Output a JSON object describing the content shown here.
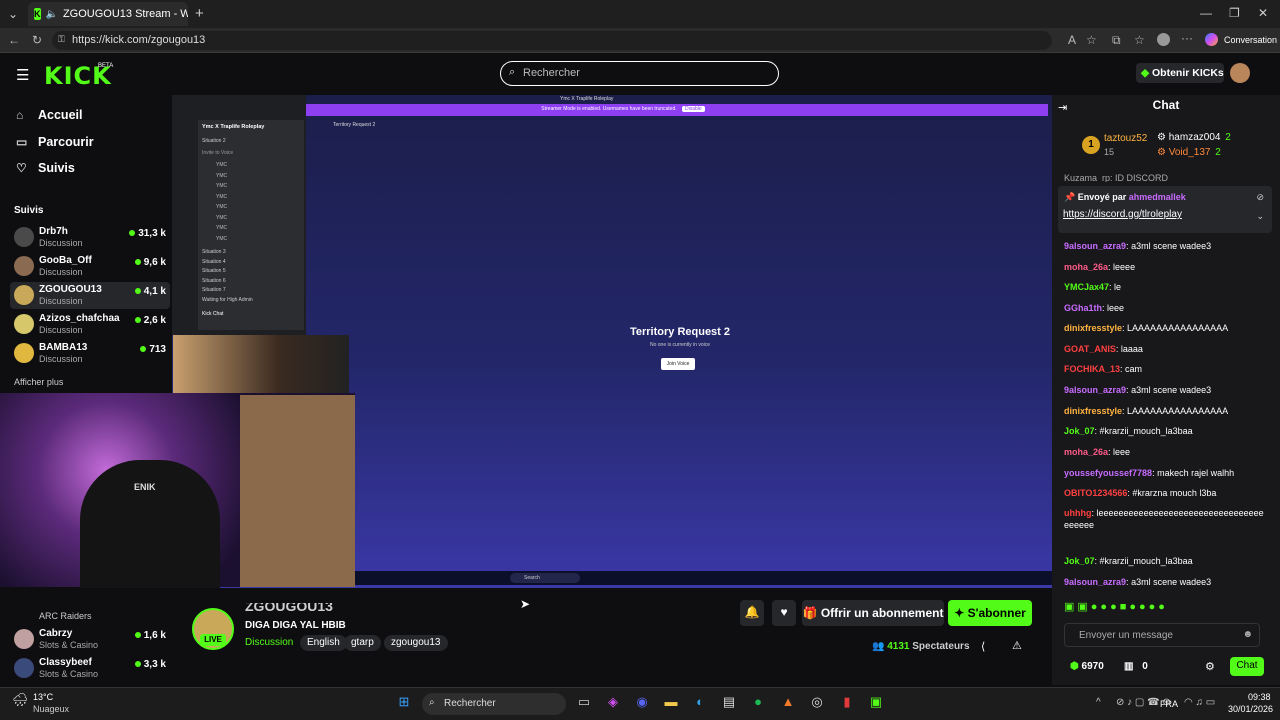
{
  "browser": {
    "tab_title": "ZGOUGOU13 Stream - Watch",
    "url": "https://kick.com/zgougou13",
    "conversation_label": "Conversation"
  },
  "header": {
    "logo": "KICK",
    "beta": "BETA",
    "search_placeholder": "Rechercher",
    "get_kicks": "Obtenir KICKs"
  },
  "sidebar": {
    "nav": [
      {
        "label": "Accueil"
      },
      {
        "label": "Parcourir"
      },
      {
        "label": "Suivis"
      }
    ],
    "section_title": "Suivis",
    "following": [
      {
        "name": "Drb7h",
        "category": "Discussion",
        "viewers": "31,3 k"
      },
      {
        "name": "GooBa_Off",
        "category": "Discussion",
        "viewers": "9,6 k"
      },
      {
        "name": "ZGOUGOU13",
        "category": "Discussion",
        "viewers": "4,1 k"
      },
      {
        "name": "Azizos_chafchaa",
        "category": "Discussion",
        "viewers": "2,6 k"
      },
      {
        "name": "BAMBA13",
        "category": "Discussion",
        "viewers": "713"
      }
    ],
    "show_more": "Afficher plus",
    "recommended_partial": "ARC Raiders",
    "recommended": [
      {
        "name": "Cabrzy",
        "category": "Slots & Casino",
        "viewers": "1,6 k"
      },
      {
        "name": "Classybeef",
        "category": "Slots & Casino",
        "viewers": "3,3 k"
      }
    ]
  },
  "player": {
    "window_title": "Ymc X Traplife Roleplay",
    "banner": "Streamer Mode is enabled. Usernames have been truncated.",
    "banner_btn": "Disable",
    "server_name": "Ymc X Traplife Roleplay",
    "channel_header": "Territory Request 2",
    "channels": [
      "Situation 2",
      "Invite to Voice",
      "Situation 3",
      "Situation 4",
      "Situation 5",
      "Situation 6",
      "Situation 7",
      "Waiting for High Admin",
      "Kick Chat"
    ],
    "voice_users": [
      "YMC",
      "YMC",
      "YMC",
      "YMC",
      "YMC",
      "YMC",
      "YMC",
      "YMC"
    ],
    "center_title": "Territory Request 2",
    "center_sub": "No one is currently in voice",
    "join_btn": "Join Voice",
    "mini_taskbar_search": "Search",
    "hoodie_text": "ENIK"
  },
  "stream": {
    "streamer_name": "ZGOUGOU13",
    "live": "LIVE",
    "title": "DIGA DIGA YAL HBIB",
    "category": "Discussion",
    "tags": [
      "English",
      "gtarp",
      "zgougou13"
    ],
    "gift_btn": "Offrir un abonnement",
    "sub_btn": "S'abonner",
    "viewers": "4131",
    "viewers_label": "Spectateurs"
  },
  "chat": {
    "title": "Chat",
    "top_gifters": [
      {
        "name": "taztouz52",
        "count": "15"
      },
      {
        "name": "hamzaz004",
        "count": "2"
      },
      {
        "name": "Void_137",
        "count": "2"
      }
    ],
    "partial_line": "Kuzama_rp: ID DISCORD",
    "pinned_by_label": "Envoyé par",
    "pinned_by": "ahmedmallek",
    "pinned_link": "https://discord.gg/tlroleplay",
    "messages": [
      {
        "user": "9alsoun_azra9",
        "color": "#c86cff",
        "text": "a3ml scene wadee3"
      },
      {
        "user": "moha_26a",
        "color": "#ff5a8a",
        "text": "leeee"
      },
      {
        "user": "YMCJax47",
        "color": "#53fc18",
        "text": "le"
      },
      {
        "user": "GGha1th",
        "color": "#c86cff",
        "text": "leee"
      },
      {
        "user": "dinixfresstyle",
        "color": "#ffb340",
        "text": "LAAAAAAAAAAAAAAAA"
      },
      {
        "user": "GOAT_ANIS",
        "color": "#ff4040",
        "text": "laaaa"
      },
      {
        "user": "FOCHIKA_13",
        "color": "#ff4040",
        "text": "cam"
      },
      {
        "user": "9alsoun_azra9",
        "color": "#c86cff",
        "text": "a3ml scene wadee3"
      },
      {
        "user": "dinixfresstyle",
        "color": "#ffb340",
        "text": "LAAAAAAAAAAAAAAAA"
      },
      {
        "user": "Jok_07",
        "color": "#53fc18",
        "text": "#krarzii_mouch_la3baa"
      },
      {
        "user": "moha_26a",
        "color": "#ff5a8a",
        "text": "leee"
      },
      {
        "user": "youssefyoussef7788",
        "color": "#c86cff",
        "text": "makech rajel walhh"
      },
      {
        "user": "OBITO1234566",
        "color": "#ff4040",
        "text": "#krarzna mouch l3ba"
      },
      {
        "user": "uhhhg",
        "color": "#ff4040",
        "text": "leeeeeeeeeeeeeeeeeeeeeeeeeeeeeeeeeeeeeee"
      },
      {
        "user": "Jok_07",
        "color": "#53fc18",
        "text": "#krarzii_mouch_la3baa"
      },
      {
        "user": "9alsoun_azra9",
        "color": "#c86cff",
        "text": "a3ml scene wadee3"
      }
    ],
    "input_placeholder": "Envoyer un message",
    "points": "6970",
    "other_count": "0",
    "chat_btn": "Chat"
  },
  "taskbar": {
    "temp": "13°C",
    "weather": "Nuageux",
    "search": "Rechercher",
    "lang": "FRA",
    "time": "09:38",
    "date": "30/01/2026"
  },
  "colors": {
    "brand": "#53fc18",
    "bg": "#0e0e10",
    "chat_bg": "#18181b"
  }
}
